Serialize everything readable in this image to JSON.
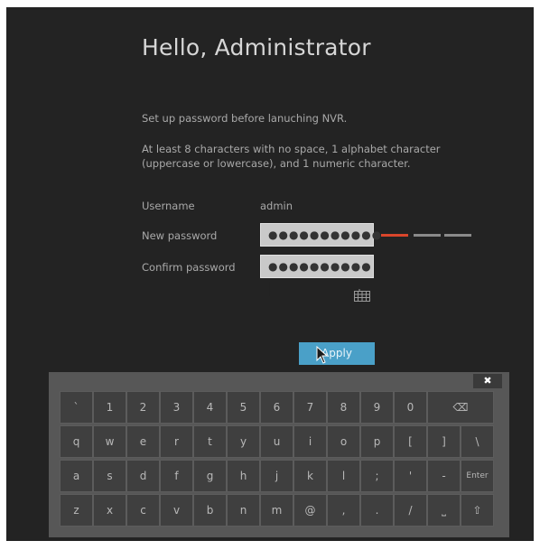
{
  "title": "Hello, Administrator",
  "instructions": {
    "line1": "Set up password before lanuching NVR.",
    "line2": "At least 8 characters with no space, 1 alphabet character",
    "line3": "(uppercase or lowercase), and 1 numeric character."
  },
  "form": {
    "username_label": "Username",
    "username_value": "admin",
    "new_password_label": "New password",
    "new_password_value": "●●●●●●●●●●●",
    "confirm_password_label": "Confirm password",
    "confirm_password_value": "●●●●●●●●●●"
  },
  "strength_meter": {
    "level": 1,
    "max": 3,
    "colors": [
      "#d9452b",
      "#8a8a8a",
      "#8a8a8a"
    ]
  },
  "apply_label": "Apply",
  "keyboard": {
    "close_label": "✖",
    "row1": [
      "`",
      "1",
      "2",
      "3",
      "4",
      "5",
      "6",
      "7",
      "8",
      "9",
      "0"
    ],
    "row2": [
      "q",
      "w",
      "e",
      "r",
      "t",
      "y",
      "u",
      "i",
      "o",
      "p",
      "[",
      "]",
      "\\"
    ],
    "row3": [
      "a",
      "s",
      "d",
      "f",
      "g",
      "h",
      "j",
      "k",
      "l",
      ";",
      "'",
      "-"
    ],
    "row4": [
      "z",
      "x",
      "c",
      "v",
      "b",
      "n",
      "m",
      "@",
      ",",
      ".",
      "/"
    ],
    "backspace_label": "⌫",
    "enter_label": "Enter",
    "space_label": "⎵",
    "shift_label": "⇧"
  }
}
